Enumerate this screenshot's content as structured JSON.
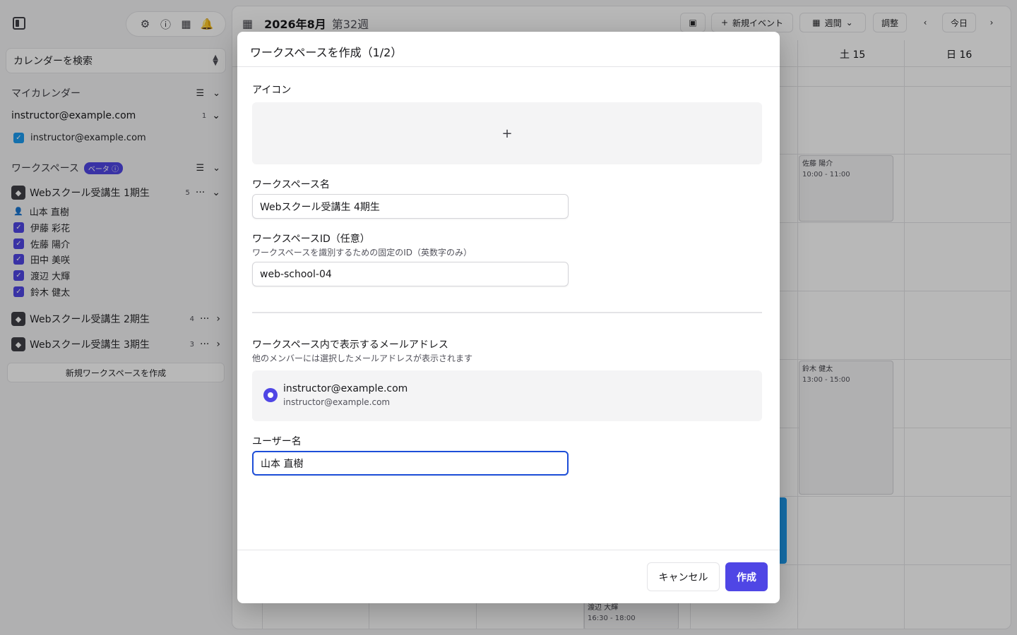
{
  "sidebar": {
    "search_label": "カレンダーを検索",
    "my_calendar_title": "マイカレンダー",
    "account": {
      "email": "instructor@example.com",
      "count": "1",
      "calendar": "instructor@example.com"
    },
    "workspace_title": "ワークスペース",
    "beta_label": "ベータ",
    "workspaces": [
      {
        "name": "Webスクール受講生 1期生",
        "count": "5",
        "members": [
          "山本 直樹",
          "伊藤 彩花",
          "佐藤 陽介",
          "田中 美咲",
          "渡辺 大輝",
          "鈴木 健太"
        ]
      },
      {
        "name": "Webスクール受講生 2期生",
        "count": "4"
      },
      {
        "name": "Webスクール受講生 3期生",
        "count": "3"
      }
    ],
    "new_workspace_button": "新規ワークスペースを作成"
  },
  "calendar": {
    "month": "2026年8月",
    "week": "第32週",
    "new_event_button": "新規イベント",
    "view_button": "週間",
    "adjust_button": "調整",
    "today_button": "今日",
    "days": [
      {
        "label": "土 15"
      },
      {
        "label": "日 16"
      }
    ],
    "events": [
      {
        "name": "佐藤 陽介",
        "time": "10:00 - 11:00"
      },
      {
        "name": "鈴木 健太",
        "time": "13:00 - 15:00"
      },
      {
        "name": "渡辺 大輝",
        "time": "16:30 - 18:00"
      }
    ]
  },
  "modal": {
    "title": "ワークスペースを作成（1/2）",
    "icon_label": "アイコン",
    "icon_add": "+",
    "name_label": "ワークスペース名",
    "name_value": "Webスクール受講生 4期生",
    "id_label": "ワークスペースID（任意）",
    "id_hint": "ワークスペースを識別するための固定のID（英数字のみ）",
    "id_value": "web-school-04",
    "email_label": "ワークスペース内で表示するメールアドレス",
    "email_hint": "他のメンバーには選択したメールアドレスが表示されます",
    "email_option": {
      "main": "instructor@example.com",
      "sub": "instructor@example.com"
    },
    "username_label": "ユーザー名",
    "username_value": "山本 直樹",
    "cancel_button": "キャンセル",
    "create_button": "作成"
  },
  "colors": {
    "accent": "#4f46e5",
    "focus": "#1d4ed8",
    "event_blue": "#1d9bf0"
  }
}
